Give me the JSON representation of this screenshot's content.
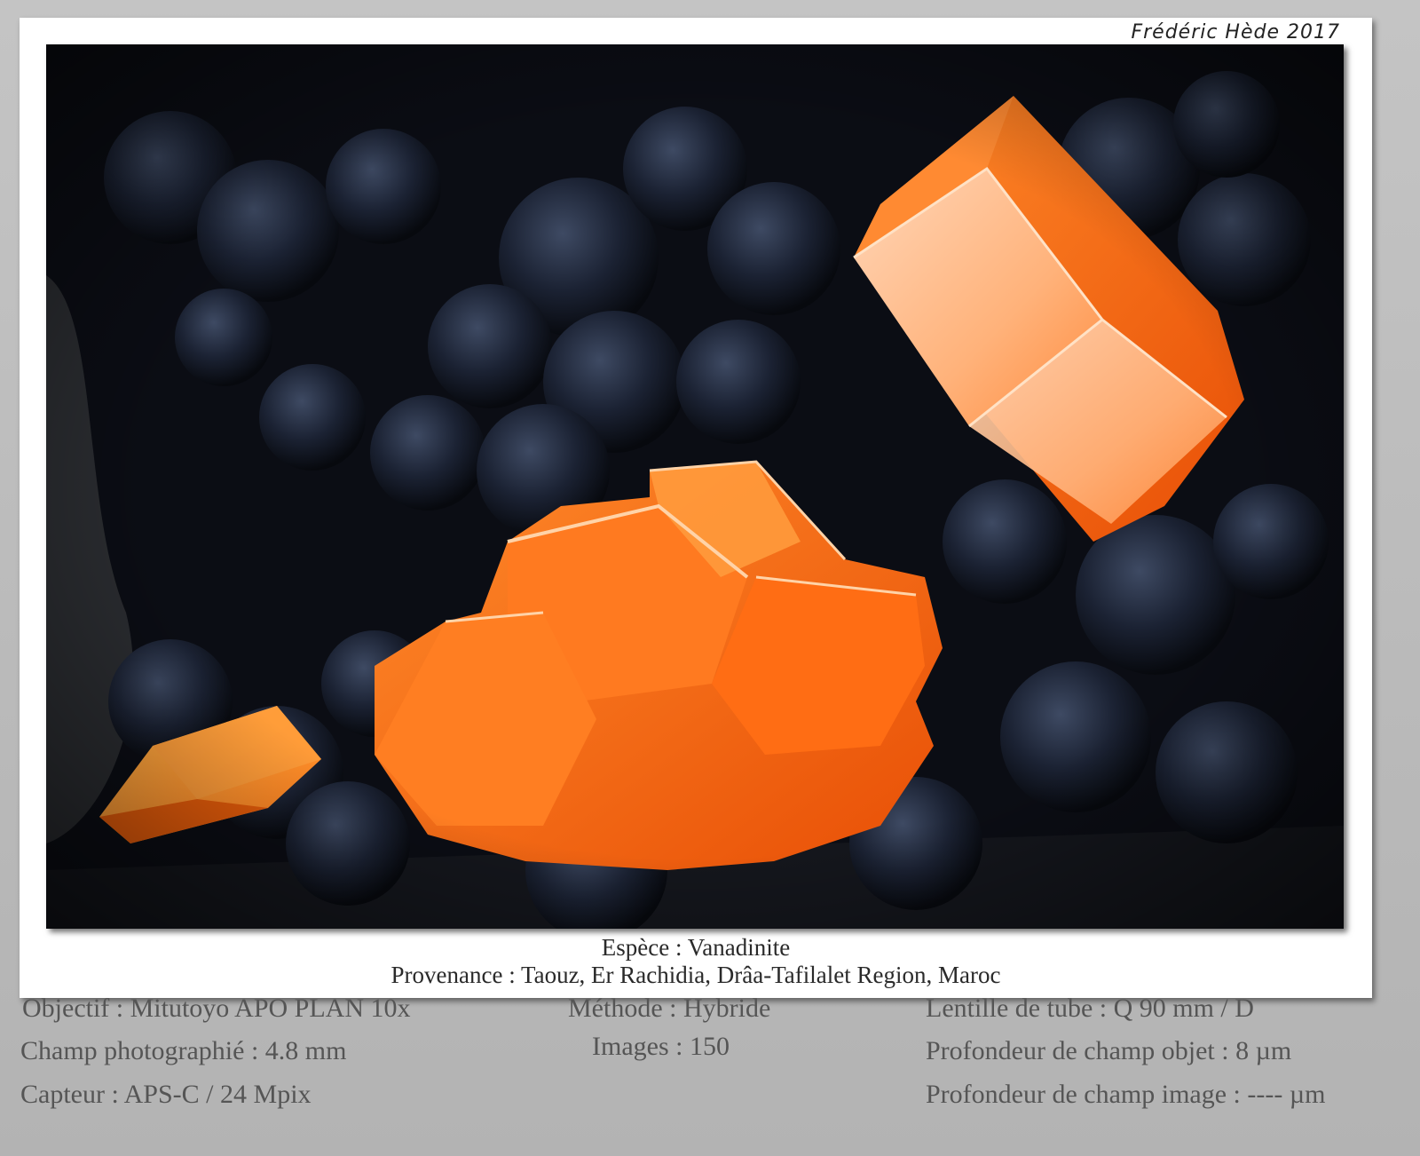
{
  "credit": "Frédéric Hède 2017",
  "caption": {
    "species": "Espèce : Vanadinite",
    "provenance": "Provenance : Taouz, Er Rachidia, Drâa-Tafilalet Region, Maroc"
  },
  "specs": {
    "objective": "Objectif : Mitutoyo APO PLAN 10x",
    "field": "Champ photographié : 4.8 mm",
    "sensor": "Capteur : APS-C / 24 Mpix",
    "method": "Méthode : Hybride",
    "images": "Images : 150",
    "tube_lens": "Lentille de tube : Q 90 mm / D",
    "dof_object": "Profondeur de champ objet : 8 µm",
    "dof_image": "Profondeur de champ image : ---- µm"
  },
  "colors": {
    "background": "#0b0d14",
    "matrix": "#1b2233",
    "crystal": "#ff6a10",
    "crystal_highlight": "#ffc08a"
  }
}
